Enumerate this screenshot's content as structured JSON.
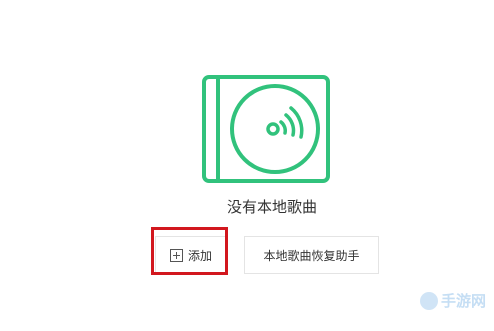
{
  "empty_state": {
    "title": "没有本地歌曲",
    "accent_color": "#31c27c"
  },
  "actions": {
    "add_label": "添加",
    "restore_label": "本地歌曲恢复助手"
  },
  "icons": {
    "empty": "cd-disc-icon",
    "add": "plus-square-icon"
  },
  "watermark": {
    "text": "手游网"
  }
}
